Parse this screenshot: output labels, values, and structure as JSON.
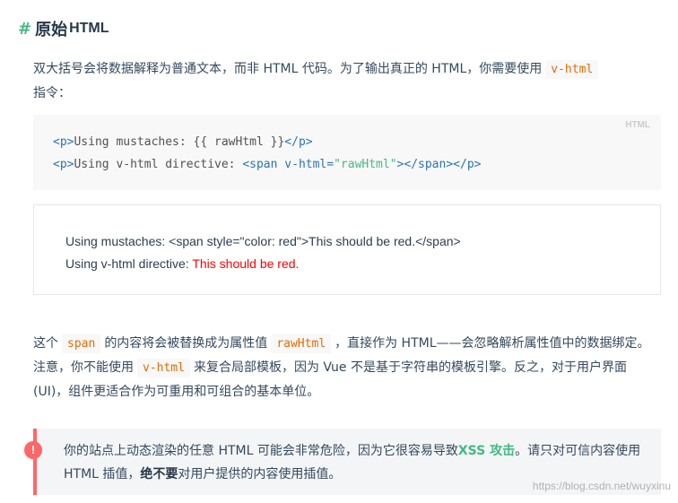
{
  "heading": {
    "hash": "#",
    "title_zh": "原始",
    "title_en": "HTML"
  },
  "intro": {
    "text_before": "双大括号会将数据解释为普通文本，而非 HTML 代码。为了输出真正的 HTML，你需要使用",
    "code": "v-html",
    "text_after": "指令："
  },
  "code_block": {
    "lang": "HTML",
    "line1": {
      "open": "<p>",
      "text": "Using mustaches: {{ rawHtml }}",
      "close": "</p>"
    },
    "line2": {
      "open": "<p>",
      "text": "Using v-html directive: ",
      "span_open": "<span",
      "attr": " v-html=",
      "attr_value": "\"rawHtml\"",
      "span_end": "></span>",
      "close": "</p>"
    }
  },
  "demo": {
    "line1": "Using mustaches: <span style=\"color: red\">This should be red.</span>",
    "line2_label": "Using v-html directive: ",
    "line2_red": "This should be red."
  },
  "para2": {
    "t1": "这个",
    "c1": "span",
    "t2": "的内容将会被替换成为属性值",
    "c2": "rawHtml",
    "t3": "，直接作为 HTML——会忽略解析属性值中的数据绑定。注意，你不能使用",
    "c3": "v-html",
    "t4": "来复合局部模板，因为 Vue 不是基于字符串的模板引擎。反之，对于用户界面 (UI)，组件更适合作为可重用和可组合的基本单位。"
  },
  "tip": {
    "icon": "!",
    "t1": "你的站点上动态渲染的任意 HTML 可能会非常危险，因为它很容易导致",
    "link": "XSS 攻击",
    "t2": "。请只对可信内容使用 HTML 插值，",
    "bold": "绝不要",
    "t3": "对用户提供的内容使用插值。"
  },
  "watermark": "https://blog.csdn.net/wuyxinu",
  "colors": {
    "accent": "#42b983",
    "warning": "#ff6666",
    "inline_code": "#e96900",
    "tag": "#2973b7"
  }
}
